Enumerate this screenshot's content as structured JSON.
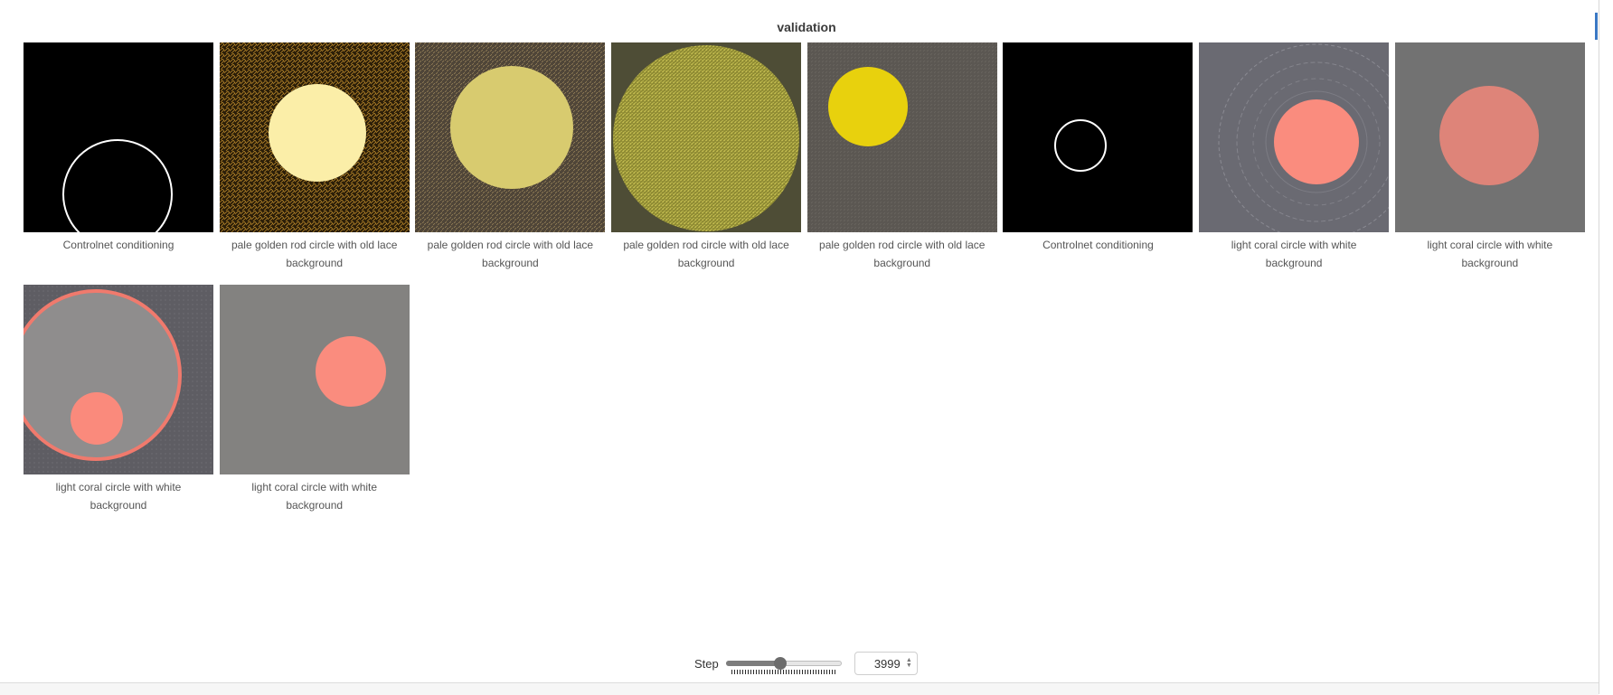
{
  "panel": {
    "title": "validation"
  },
  "images": [
    {
      "caption": "Controlnet conditioning"
    },
    {
      "caption": "pale golden rod circle with old lace background"
    },
    {
      "caption": "pale golden rod circle with old lace background"
    },
    {
      "caption": "pale golden rod circle with old lace background"
    },
    {
      "caption": "pale golden rod circle with old lace background"
    },
    {
      "caption": "Controlnet conditioning"
    },
    {
      "caption": "light coral circle with white background"
    },
    {
      "caption": "light coral circle with white background"
    },
    {
      "caption": "light coral circle with white background"
    },
    {
      "caption": "light coral circle with white background"
    }
  ],
  "step": {
    "label": "Step",
    "value": "3999",
    "slider_fraction": 0.47
  },
  "colors": {
    "accent": "#3a78c4",
    "pale_golden_rod": "#f8eda6",
    "light_coral": "#fa8c7e",
    "gold": "#e8d10d"
  }
}
